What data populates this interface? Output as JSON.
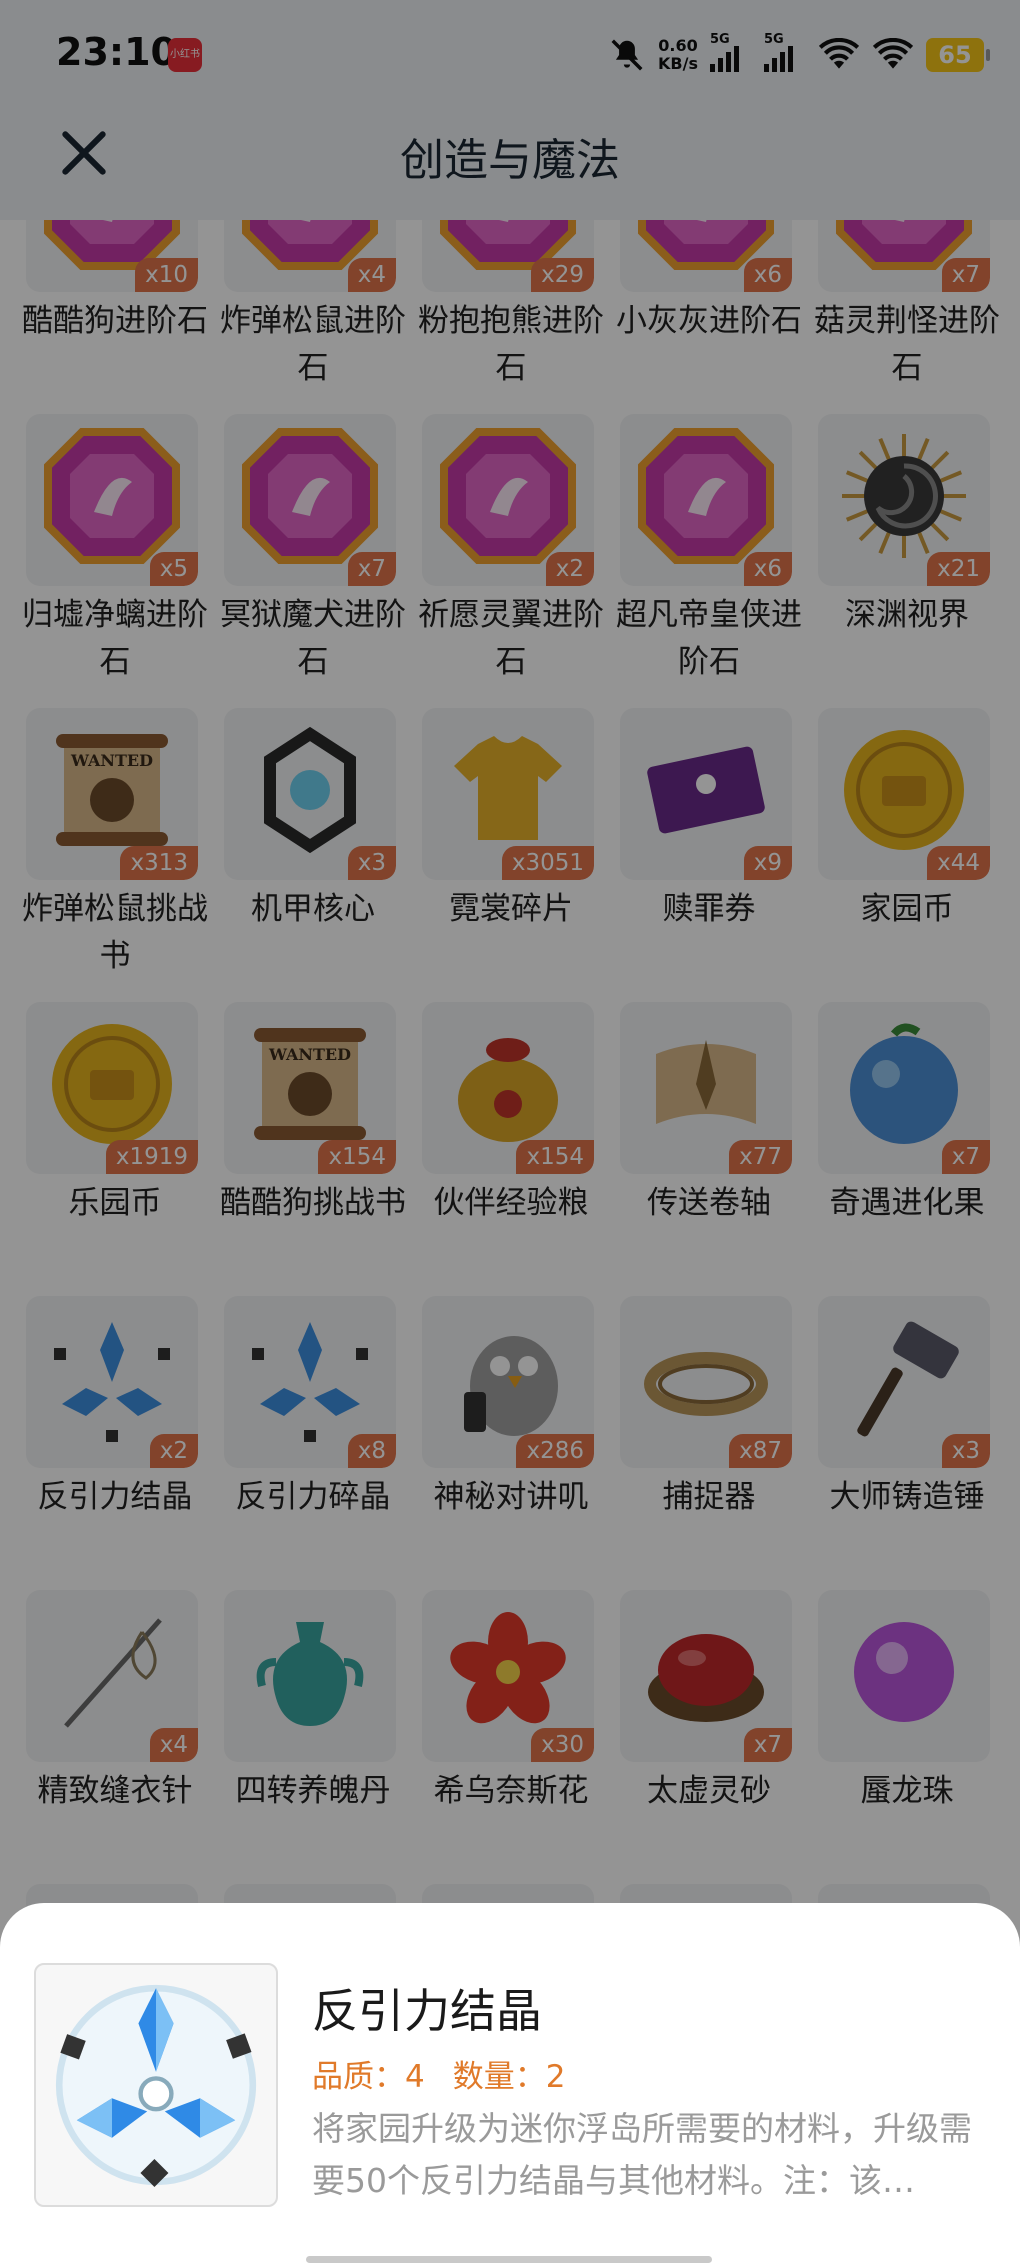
{
  "status_bar": {
    "time": "23:10",
    "notification_badge": "小红书",
    "net_speed_value": "0.60",
    "net_speed_unit": "KB/s",
    "sim1": "5G",
    "sim2": "5G",
    "battery": "65"
  },
  "header": {
    "title": "创造与魔法",
    "close_icon": "close-icon"
  },
  "items": [
    {
      "name": "酷酷狗进阶石",
      "count": "x10",
      "icon": "gem-icon",
      "color": "#c53aa8"
    },
    {
      "name": "炸弹松鼠进阶石",
      "count": "x4",
      "icon": "gem-icon",
      "color": "#c53aa8"
    },
    {
      "name": "粉抱抱熊进阶石",
      "count": "x29",
      "icon": "gem-icon",
      "color": "#c53aa8"
    },
    {
      "name": "小灰灰进阶石",
      "count": "x6",
      "icon": "gem-icon",
      "color": "#c53aa8"
    },
    {
      "name": "菇灵荆怪进阶石",
      "count": "x7",
      "icon": "gem-icon",
      "color": "#c53aa8"
    },
    {
      "name": "归墟净螭进阶石",
      "count": "x5",
      "icon": "gem-icon",
      "color": "#c53aa8"
    },
    {
      "name": "冥狱魔犬进阶石",
      "count": "x7",
      "icon": "gem-icon",
      "color": "#c53aa8"
    },
    {
      "name": "祈愿灵翼进阶石",
      "count": "x2",
      "icon": "gem-icon",
      "color": "#c53aa8"
    },
    {
      "name": "超凡帝皇侠进阶石",
      "count": "x6",
      "icon": "gem-icon",
      "color": "#c53aa8"
    },
    {
      "name": "深渊视界",
      "count": "x21",
      "icon": "vortex-icon",
      "color": "#3a3a3a"
    },
    {
      "name": "炸弹松鼠挑战书",
      "count": "x313",
      "icon": "wanted-scroll-icon",
      "color": "#8a5a32"
    },
    {
      "name": "机甲核心",
      "count": "x3",
      "icon": "mech-core-icon",
      "color": "#2a2a2a"
    },
    {
      "name": "霓裳碎片",
      "count": "x3051",
      "icon": "shirt-icon",
      "color": "#e7b22a"
    },
    {
      "name": "赎罪券",
      "count": "x9",
      "icon": "ticket-icon",
      "color": "#6a2a8a"
    },
    {
      "name": "家园币",
      "count": "x44",
      "icon": "coin-icon",
      "color": "#e6b31e"
    },
    {
      "name": "乐园币",
      "count": "x1919",
      "icon": "coin-icon",
      "color": "#e6b31e"
    },
    {
      "name": "酷酷狗挑战书",
      "count": "x154",
      "icon": "wanted-scroll-icon",
      "color": "#8a5a32"
    },
    {
      "name": "伙伴经验粮",
      "count": "x154",
      "icon": "food-bag-icon",
      "color": "#d9a526"
    },
    {
      "name": "传送卷轴",
      "count": "x77",
      "icon": "scroll-icon",
      "color": "#8a6a3a"
    },
    {
      "name": "奇遇进化果",
      "count": "x7",
      "icon": "fruit-icon",
      "color": "#4d8fd6"
    },
    {
      "name": "反引力结晶",
      "count": "x2",
      "icon": "crystal-icon",
      "color": "#3d8fe0"
    },
    {
      "name": "反引力碎晶",
      "count": "x8",
      "icon": "crystal-icon",
      "color": "#3d8fe0"
    },
    {
      "name": "神秘对讲叽",
      "count": "x286",
      "icon": "bird-radio-icon",
      "color": "#a0a0a0"
    },
    {
      "name": "捕捉器",
      "count": "x87",
      "icon": "thorn-crown-icon",
      "color": "#b8965a"
    },
    {
      "name": "大师铸造锤",
      "count": "x3",
      "icon": "hammer-icon",
      "color": "#5a5a6a"
    },
    {
      "name": "精致缝衣针",
      "count": "x4",
      "icon": "needle-icon",
      "color": "#6a6a6a"
    },
    {
      "name": "四转养魄丹",
      "count": "",
      "icon": "vase-icon",
      "color": "#3aa6a0"
    },
    {
      "name": "希乌奈斯花",
      "count": "x30",
      "icon": "flower-icon",
      "color": "#e23a2a"
    },
    {
      "name": "太虚灵砂",
      "count": "x7",
      "icon": "red-orb-icon",
      "color": "#c0282a"
    },
    {
      "name": "蜃龙珠",
      "count": "",
      "icon": "purple-orb-icon",
      "color": "#b03ad8"
    },
    {
      "name": "",
      "count": "",
      "icon": "dark-banner-icon",
      "color": "#1a2a3a"
    },
    {
      "name": "",
      "count": "",
      "icon": "dark-banner-icon",
      "color": "#1a2a3a"
    },
    {
      "name": "",
      "count": "",
      "icon": "flower-icon",
      "color": "#e05a8a"
    },
    {
      "name": "",
      "count": "",
      "icon": "sword-icon",
      "color": "#c8a050"
    },
    {
      "name": "",
      "count": "",
      "icon": "chest-icon",
      "color": "#5a4a3a"
    }
  ],
  "detail_sheet": {
    "title": "反引力结晶",
    "quality_label": "品质：",
    "quality_value": "4",
    "quantity_label": "数量：",
    "quantity_value": "2",
    "description": "将家园升级为迷你浮岛所需要的材料，升级需要50个反引力结晶与其他材料。注：该…"
  }
}
